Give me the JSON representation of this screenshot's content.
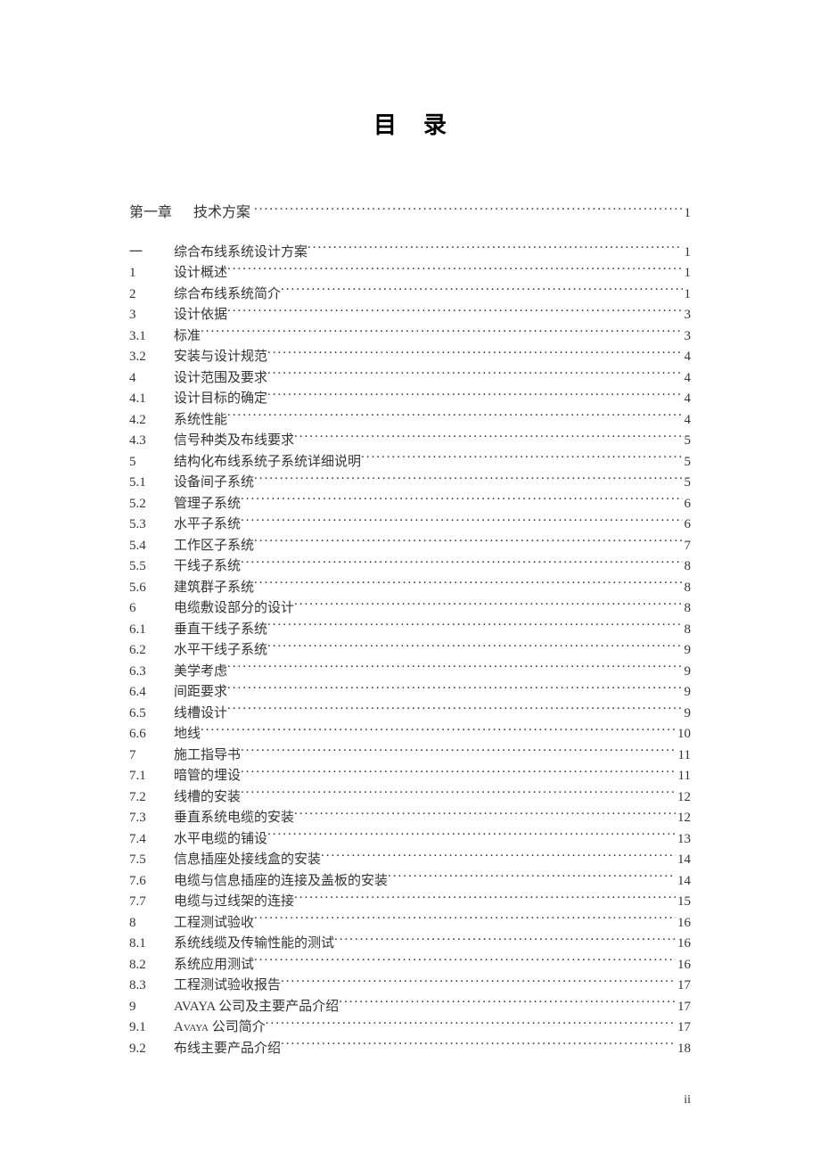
{
  "title": "目录",
  "page_footer": "ii",
  "chapter": {
    "num": "第一章",
    "label": "技术方案",
    "page": "1"
  },
  "entries": [
    {
      "num": "一",
      "label": "综合布线系统设计方案",
      "page": "1"
    },
    {
      "num": "1",
      "label": "设计概述",
      "page": "1"
    },
    {
      "num": "2",
      "label": "综合布线系统简介",
      "page": "1"
    },
    {
      "num": "3",
      "label": "设计依据",
      "page": "3"
    },
    {
      "num": "3.1",
      "label": "标准",
      "page": "3"
    },
    {
      "num": "3.2",
      "label": "安装与设计规范",
      "page": "4"
    },
    {
      "num": "4",
      "label": "设计范围及要求",
      "page": "4"
    },
    {
      "num": "4.1",
      "label": "设计目标的确定",
      "page": "4"
    },
    {
      "num": "4.2",
      "label": "系统性能",
      "page": "4"
    },
    {
      "num": "4.3",
      "label": "信号种类及布线要求",
      "page": "5"
    },
    {
      "num": "5",
      "label": "结构化布线系统子系统详细说明",
      "page": "5"
    },
    {
      "num": "5.1",
      "label": "设备间子系统",
      "page": "5"
    },
    {
      "num": "5.2",
      "label": "管理子系统",
      "page": "6"
    },
    {
      "num": "5.3",
      "label": "水平子系统",
      "page": "6"
    },
    {
      "num": "5.4",
      "label": "工作区子系统",
      "page": "7"
    },
    {
      "num": "5.5",
      "label": "干线子系统",
      "page": "8"
    },
    {
      "num": "5.6",
      "label": "建筑群子系统",
      "page": "8"
    },
    {
      "num": "6",
      "label": "电缆敷设部分的设计",
      "page": "8"
    },
    {
      "num": "6.1",
      "label": "垂直干线子系统",
      "page": "8"
    },
    {
      "num": "6.2",
      "label": "水平干线子系统",
      "page": "9"
    },
    {
      "num": "6.3",
      "label": "美学考虑",
      "page": "9"
    },
    {
      "num": "6.4",
      "label": "间距要求",
      "page": "9"
    },
    {
      "num": "6.5",
      "label": "线槽设计",
      "page": "9"
    },
    {
      "num": "6.6",
      "label": "地线",
      "page": "10"
    },
    {
      "num": "7",
      "label": "施工指导书",
      "page": "11"
    },
    {
      "num": "7.1",
      "label": "暗管的埋设",
      "page": "11"
    },
    {
      "num": "7.2",
      "label": "线槽的安装",
      "page": "12"
    },
    {
      "num": "7.3",
      "label": "垂直系统电缆的安装",
      "page": "12"
    },
    {
      "num": "7.4",
      "label": "水平电缆的铺设",
      "page": "13"
    },
    {
      "num": "7.5",
      "label": "信息插座处接线盒的安装",
      "page": "14"
    },
    {
      "num": "7.6",
      "label": "电缆与信息插座的连接及盖板的安装",
      "page": "14"
    },
    {
      "num": "7.7",
      "label": "电缆与过线架的连接",
      "page": "15"
    },
    {
      "num": "8",
      "label": "工程测试验收",
      "page": "16"
    },
    {
      "num": "8.1",
      "label": "系统线缆及传输性能的测试",
      "page": "16"
    },
    {
      "num": "8.2",
      "label": "系统应用测试",
      "page": "16"
    },
    {
      "num": "8.3",
      "label": "工程测试验收报告",
      "page": "17"
    },
    {
      "num": "9",
      "label": "AVAYA 公司及主要产品介绍",
      "page": "17"
    },
    {
      "num": "9.1",
      "label": "Avaya 公司简介",
      "page": "17",
      "smallcaps": true
    },
    {
      "num": "9.2",
      "label": "布线主要产品介绍",
      "page": "18"
    }
  ]
}
